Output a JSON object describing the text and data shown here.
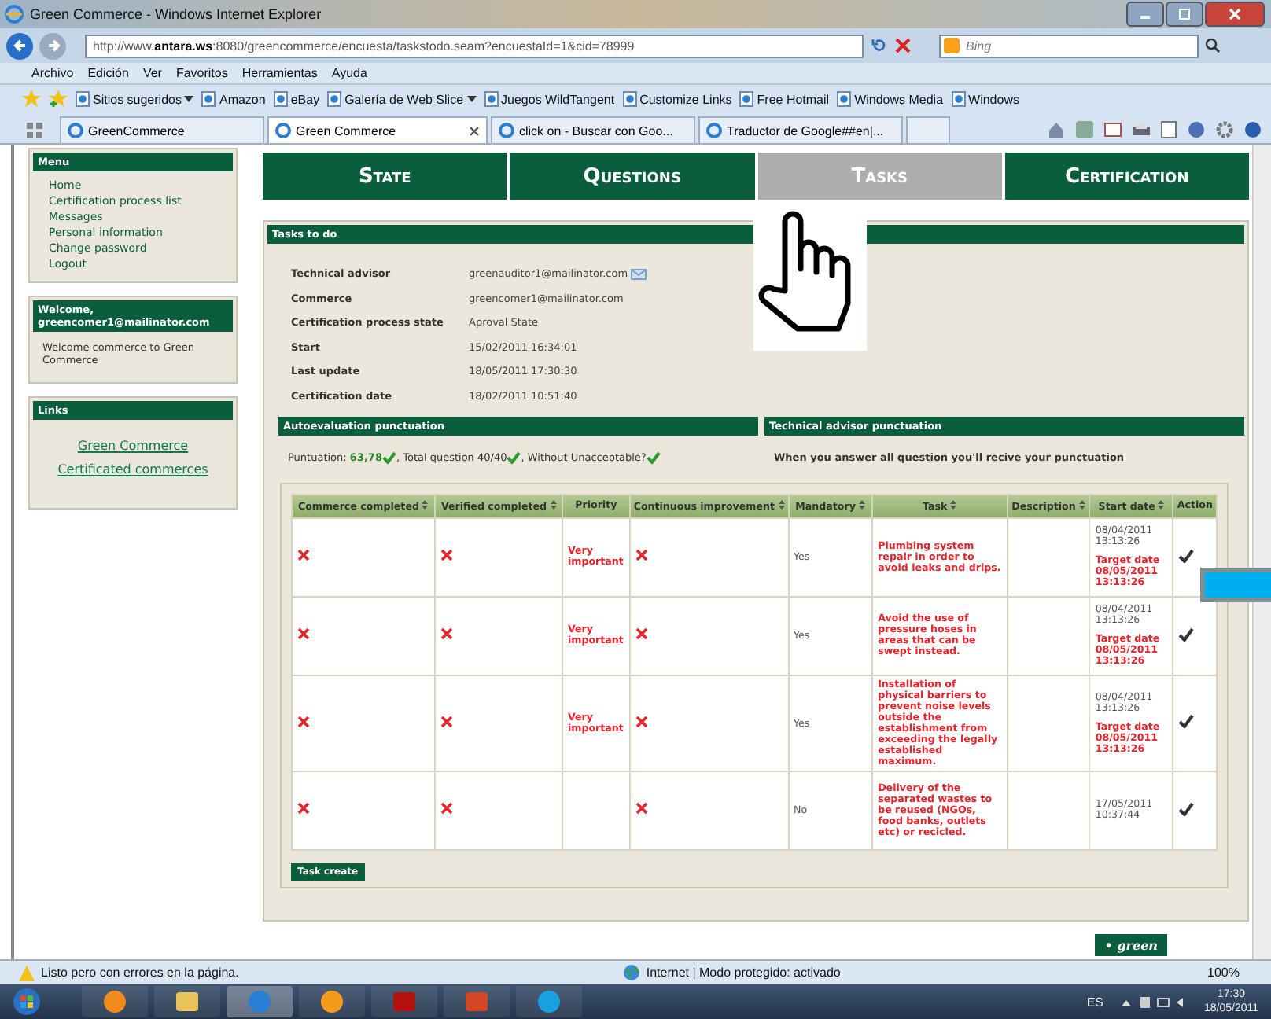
{
  "window": {
    "title": "Green Commerce - Windows Internet Explorer"
  },
  "address_bar": {
    "url": "http://www.**antara.ws**:8080/greencommerce/encuesta/taskstodo.seam?encuestaId=1&cid=78999"
  },
  "search": {
    "placeholder": "Bing"
  },
  "menu": [
    "Archivo",
    "Edición",
    "Ver",
    "Favoritos",
    "Herramientas",
    "Ayuda"
  ],
  "favorites": [
    {
      "label": "Sitios sugeridos",
      "dropdown": true
    },
    {
      "label": "Amazon",
      "dropdown": false
    },
    {
      "label": "eBay",
      "dropdown": false
    },
    {
      "label": "Galería de Web Slice",
      "dropdown": true
    },
    {
      "label": "Juegos WildTangent",
      "dropdown": false
    },
    {
      "label": "Customize Links",
      "dropdown": false
    },
    {
      "label": "Free Hotmail",
      "dropdown": false
    },
    {
      "label": "Windows Media",
      "dropdown": false
    },
    {
      "label": "Windows",
      "dropdown": false
    }
  ],
  "browser_tabs": [
    {
      "label": "GreenCommerce",
      "selected": false
    },
    {
      "label": "Green Commerce",
      "selected": true
    },
    {
      "label": "click on - Buscar con Goo...",
      "selected": false
    },
    {
      "label": "Traductor de Google##en|...",
      "selected": false
    }
  ],
  "sidebar": {
    "menu": {
      "title": "Menu",
      "items": [
        "Home",
        "Certification process list",
        "Messages",
        "Personal information",
        "Change password",
        "Logout"
      ]
    },
    "welcome": {
      "title": "Welcome, greencomer1@mailinator.com",
      "text": "Welcome commerce to Green Commerce"
    },
    "links": {
      "title": "Links",
      "items": [
        "Green Commerce",
        "Certificated commerces"
      ]
    }
  },
  "nav_tabs": [
    {
      "label": "State",
      "selected": false
    },
    {
      "label": "Questions",
      "selected": false
    },
    {
      "label": "Tasks",
      "selected": true
    },
    {
      "label": "Certification",
      "selected": false
    }
  ],
  "tasks_panel": {
    "title": "Tasks to do",
    "fields": [
      {
        "label": "Technical advisor",
        "value": "greenauditor1@mailinator.com",
        "mail": true
      },
      {
        "label": "Commerce",
        "value": "greencomer1@mailinator.com",
        "mail": false
      },
      {
        "label": "Certification process state",
        "value": "Aproval State",
        "mail": false
      },
      {
        "label": "Start",
        "value": "15/02/2011 16:34:01",
        "mail": false
      },
      {
        "label": "Last update",
        "value": "18/05/2011 17:30:30",
        "mail": false
      },
      {
        "label": "Certification date",
        "value": "18/02/2011 10:51:40",
        "mail": false
      }
    ],
    "autoevaluation": {
      "title": "Autoevaluation punctuation",
      "parts": [
        {
          "label": "Puntuation: ",
          "value": "63,78",
          "checked": true
        },
        {
          "label": ", Total question 40/40",
          "checked": true
        },
        {
          "label": ", Without Unacceptable?",
          "checked": true
        }
      ]
    },
    "technical": {
      "title": "Technical advisor punctuation",
      "text": "When you answer all question you'll recive your punctuation"
    },
    "table": {
      "columns": [
        {
          "label": "Commerce completed",
          "sortable": true
        },
        {
          "label": "Verified completed",
          "sortable": true
        },
        {
          "label": "Priority",
          "sortable": false
        },
        {
          "label": "Continuous improvement",
          "sortable": true
        },
        {
          "label": "Mandatory",
          "sortable": true
        },
        {
          "label": "Task",
          "sortable": true
        },
        {
          "label": "Description",
          "sortable": true
        },
        {
          "label": "Start date",
          "sortable": true
        },
        {
          "label": "Action",
          "sortable": false
        }
      ],
      "rows": [
        {
          "commerce_completed": false,
          "verified_completed": false,
          "priority": "Very important",
          "continuous_improvement": false,
          "mandatory": "Yes",
          "task": "Plumbing system repair in order to avoid leaks and drips.",
          "start": "08/04/2011\n13:13:26",
          "target": "Target date\n08/05/2011\n13:13:26",
          "done": true
        },
        {
          "commerce_completed": false,
          "verified_completed": false,
          "priority": "Very important",
          "continuous_improvement": false,
          "mandatory": "Yes",
          "task": "Avoid the use of pressure hoses in areas that can be swept instead.",
          "start": "08/04/2011\n13:13:26",
          "target": "Target date\n08/05/2011\n13:13:26",
          "done": true
        },
        {
          "commerce_completed": false,
          "verified_completed": false,
          "priority": "Very important",
          "continuous_improvement": false,
          "mandatory": "Yes",
          "task": "Installation of physical barriers to prevent noise levels outside the establishment from exceeding the legally established maximum.",
          "start": "08/04/2011\n13:13:26",
          "target": "Target date\n08/05/2011\n13:13:26",
          "done": true
        },
        {
          "commerce_completed": false,
          "verified_completed": false,
          "continuous_improvement": false,
          "mandatory": "No",
          "task": "Delivery of the separated wastes to be reused (NGOs, food banks, outlets etc) or recicled.",
          "start": "17/05/2011\n10:37:44",
          "done": true
        }
      ]
    },
    "task_create_button": "Task create"
  },
  "footer": {
    "logo": "• green"
  },
  "status_bar": {
    "text": "Listo pero con errores en la página.",
    "zone": "Internet | Modo protegido: activado",
    "zoom": "100%"
  },
  "taskbar": {
    "apps": [
      {
        "kind": "media",
        "active": false
      },
      {
        "kind": "folder",
        "active": false
      },
      {
        "kind": "browser",
        "active": true
      },
      {
        "kind": "orange",
        "active": false
      },
      {
        "kind": "pdf",
        "active": false
      },
      {
        "kind": "slides",
        "active": false
      },
      {
        "kind": "chat",
        "active": false
      }
    ],
    "language": "ES",
    "time": "17:30",
    "date": "18/05/2011"
  }
}
